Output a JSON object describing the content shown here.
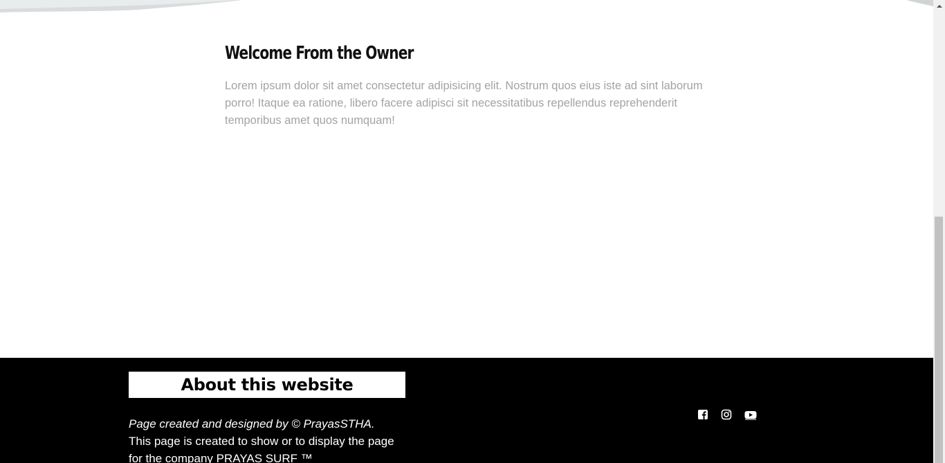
{
  "welcome": {
    "title": "Welcome From the Owner",
    "body": "Lorem ipsum dolor sit amet consectetur adipisicing elit. Nostrum quos eius iste ad sint laborum porro! Itaque ea ratione, libero facere adipisci sit necessitatibus repellendus reprehenderit temporibus amet quos numquam!"
  },
  "footer": {
    "about_title": "About this website",
    "credit": "Page created and designed by © PrayasSTHA.",
    "description": "This page is created to show or to display the page for the company PRAYAS SURF ™",
    "social_icons": [
      "facebook-icon",
      "instagram-icon",
      "youtube-icon"
    ]
  },
  "colors": {
    "footer_bg": "#000000",
    "body_text": "#a3a3a3",
    "heading": "#111111"
  }
}
